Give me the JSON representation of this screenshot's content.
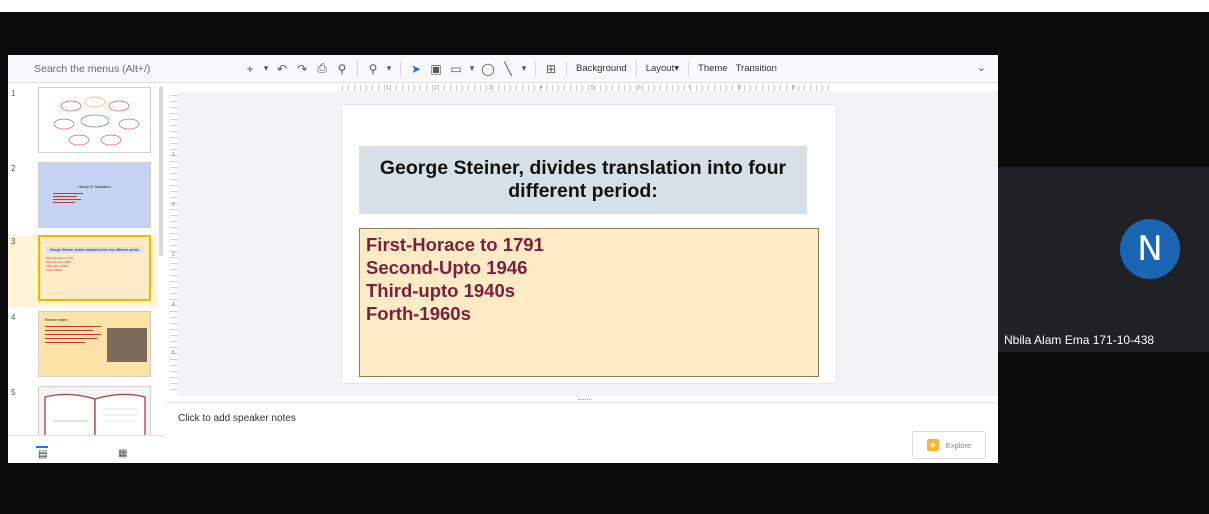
{
  "toolbar": {
    "search_placeholder": "Search the menus (Alt+/)",
    "background_label": "Background",
    "layout_label": "Layout",
    "theme_label": "Theme",
    "transition_label": "Transition",
    "icons": [
      "add-icon",
      "undo-icon",
      "redo-icon",
      "print-icon",
      "paint-format-icon",
      "zoom-icon",
      "select-icon",
      "textbox-icon",
      "image-icon",
      "shape-icon",
      "line-icon",
      "comment-icon"
    ]
  },
  "ruler": {
    "top_numbers": [
      "1",
      "2",
      "3",
      "4",
      "5",
      "6",
      "7",
      "8",
      "9"
    ],
    "left_numbers": [
      "1",
      "2",
      "3",
      "4",
      "5"
    ]
  },
  "filmstrip": {
    "thumbs": [
      {
        "number": "1"
      },
      {
        "number": "2",
        "title": "History Of Translation"
      },
      {
        "number": "3",
        "title": "George Steiner, divides translation into four different period:",
        "lines": [
          "First-Horace to 1791",
          "Second-Upto 1946",
          "Third-upto 1940s",
          "Forth-1960s"
        ]
      },
      {
        "number": "4",
        "title": "Roman empire:"
      },
      {
        "number": "5"
      }
    ],
    "selected": 3
  },
  "slide": {
    "title": "George Steiner, divides translation into four different period:",
    "body": [
      "First-Horace to 1791",
      "Second-Upto 1946",
      "Third-upto 1940s",
      "Forth-1960s"
    ],
    "colors": {
      "title_bg": "#d6e0e6",
      "body_bg": "#fdebc5",
      "body_text": "#7b1f3d"
    }
  },
  "notes": {
    "placeholder": "Click to add speaker notes"
  },
  "explore": {
    "label": "Explore"
  },
  "participant": {
    "initial": "N",
    "name": "Nbila Alam Ema 171-10-438",
    "avatar_color": "#1a66b3"
  }
}
